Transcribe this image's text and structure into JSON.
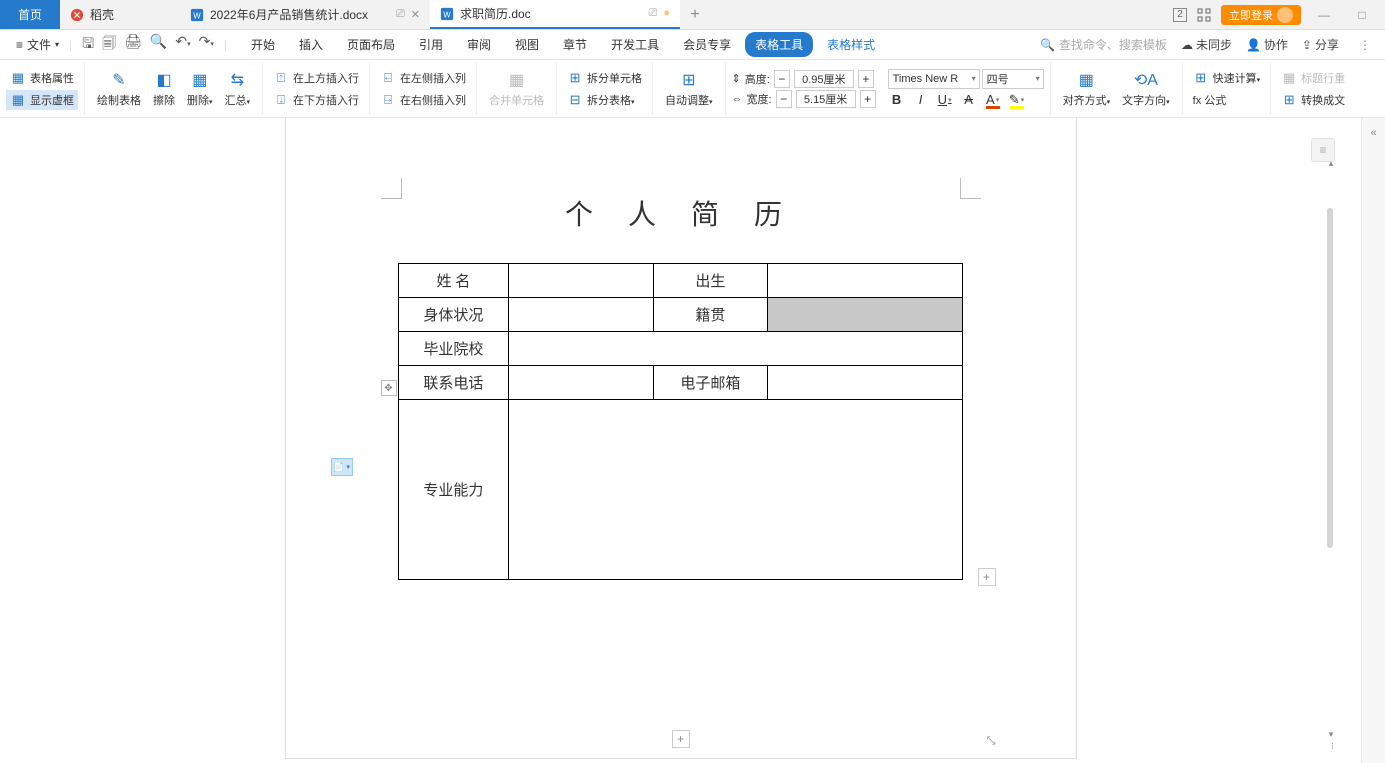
{
  "tabs": {
    "home": "首页",
    "daoke": "稻壳",
    "doc1": "2022年6月产品销售统计.docx",
    "doc2": "求职简历.doc"
  },
  "titlebar": {
    "login": "立即登录"
  },
  "menubar": {
    "file": "文件",
    "tabs": [
      "开始",
      "插入",
      "页面布局",
      "引用",
      "审阅",
      "视图",
      "章节",
      "开发工具",
      "会员专享",
      "表格工具",
      "表格样式"
    ],
    "search_placeholder": "查找命令、搜索模板",
    "unsync": "未同步",
    "coop": "协作",
    "share": "分享"
  },
  "ribbon": {
    "table_props": "表格属性",
    "show_frame": "显示虚框",
    "draw_table": "绘制表格",
    "eraser": "擦除",
    "delete": "删除",
    "summary": "汇总",
    "insert_row_above": "在上方插入行",
    "insert_row_below": "在下方插入行",
    "insert_col_left": "在左侧插入列",
    "insert_col_right": "在右侧插入列",
    "merge_cells": "合并单元格",
    "split_cells": "拆分单元格",
    "split_table": "拆分表格",
    "auto_adjust": "自动调整",
    "height_label": "高度:",
    "height_value": "0.95厘米",
    "width_label": "宽度:",
    "width_value": "5.15厘米",
    "font_name": "Times New R",
    "font_size": "四号",
    "align": "对齐方式",
    "text_dir": "文字方向",
    "quick_calc": "快速计算",
    "formula": "fx 公式",
    "title_row_repeat": "标题行重",
    "convert_text": "转换成文"
  },
  "document": {
    "title": "个 人 简 历",
    "cells": {
      "name": "姓  名",
      "birth": "出生",
      "health": "身体状况",
      "origin": "籍贯",
      "school": "毕业院校",
      "phone": "联系电话",
      "email": "电子邮箱",
      "ability": "专业能力"
    }
  }
}
